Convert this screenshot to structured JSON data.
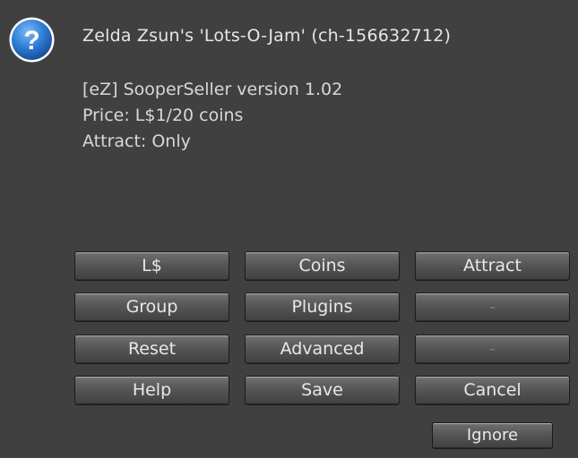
{
  "dialog": {
    "icon": "question-mark-icon",
    "title": "Zelda Zsun's 'Lots-O-Jam' (ch-156632712)",
    "lines": [
      "[eZ] SooperSeller version 1.02",
      "Price: L$1/20 coins",
      "Attract: Only"
    ]
  },
  "buttons": {
    "row1": [
      "L$",
      "Coins",
      "Attract"
    ],
    "row2": [
      "Group",
      "Plugins",
      "-"
    ],
    "row3": [
      "Reset",
      "Advanced",
      "-"
    ],
    "row4": [
      "Help",
      "Save",
      "Cancel"
    ],
    "ignore": "Ignore"
  },
  "colors": {
    "background": "#404040",
    "text": "#e6e6e6",
    "icon": "#2f7fd8"
  }
}
